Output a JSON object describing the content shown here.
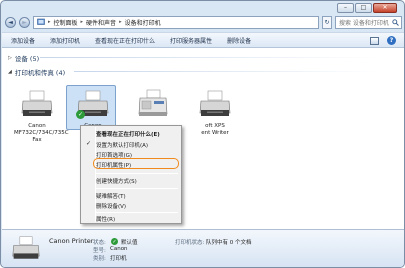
{
  "window": {
    "caption": {
      "minimize": "–",
      "maximize": "□",
      "close": "✕"
    }
  },
  "nav": {
    "back": "◄",
    "forward": "►",
    "breadcrumb": [
      "控制面板",
      "硬件和声音",
      "设备和打印机"
    ],
    "search_placeholder": "搜索 设备和打印机",
    "refresh": "↻"
  },
  "toolbar": {
    "items": [
      "添加设备",
      "添加打印机",
      "查看现在正在打印什么",
      "打印服务器属性",
      "删除设备"
    ]
  },
  "groups": {
    "devices": {
      "label": "设备 (5)"
    },
    "printers": {
      "label": "打印机和传真 (4)"
    }
  },
  "printers": [
    {
      "name": "Canon MF732C/734C/735C Fax"
    },
    {
      "name": "Canon",
      "default": true
    },
    {
      "name": ""
    },
    {
      "name": "oft XPS\nent Writer"
    }
  ],
  "context_menu": {
    "items": [
      {
        "label": "查看现在正在打印什么(E)",
        "bold": true
      },
      {
        "label": "设置为默认打印机(A)",
        "checked": true
      },
      {
        "label": "打印首选项(G)"
      },
      {
        "label": "打印机属性(P)",
        "highlighted": true
      },
      {
        "label": "创建快捷方式(S)"
      },
      {
        "label": "疑难解答(T)"
      },
      {
        "label": "删除设备(V)"
      },
      {
        "label": "属性(R)"
      }
    ]
  },
  "details": {
    "name": "Canon Printer",
    "status_label": "状态:",
    "status_value": "默认值",
    "model_label": "型号:",
    "model_value": "Canon",
    "category_label": "类别:",
    "category_value": "打印机",
    "status_right_label": "打印机状态:",
    "status_right_value": "队列中有 0 个文档"
  },
  "colors": {
    "accent_highlight": "#f08a1c",
    "selection": "#cce0f6",
    "default_badge": "#2e9b3b"
  }
}
